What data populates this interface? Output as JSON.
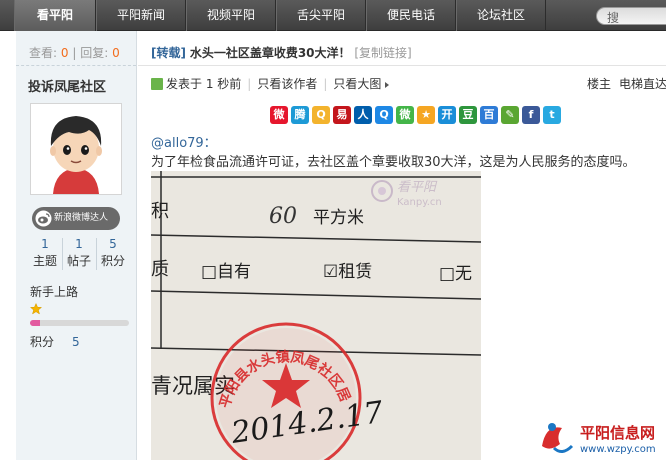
{
  "nav": {
    "tabs": [
      "看平阳",
      "平阳新闻",
      "视频平阳",
      "舌尖平阳",
      "便民电话",
      "论坛社区"
    ],
    "active_index": 0,
    "search_placeholder": "搜"
  },
  "sidebar": {
    "views_label": "查看:",
    "views_value": "0",
    "replies_label": "回复:",
    "replies_value": "0",
    "separator": "|",
    "username": "投诉凤尾社区",
    "weibo_badge": "新浪微博达人",
    "counts": [
      {
        "value": "1",
        "label": "主题"
      },
      {
        "value": "1",
        "label": "帖子"
      },
      {
        "value": "5",
        "label": "积分"
      }
    ],
    "level": "新手上路",
    "level_progress": 0.1,
    "points_label": "积分",
    "points_value": "5"
  },
  "post": {
    "tag": "[转载]",
    "title": "水头一社区盖章收费30大洋！",
    "copy_link": "[复制链接]",
    "posted": "发表于 1 秒前",
    "only_author": "只看该作者",
    "large_images": "只看大图",
    "floor": "楼主",
    "elevator": "电梯直达",
    "mention": "@allo79：",
    "body": "为了年检食品流通许可证，去社区盖个章要收取30大洋，这是为人民服务的态度吗。"
  },
  "photo": {
    "area_number": "60",
    "area_unit": "平方米",
    "watermark_title": "看平阳",
    "watermark_domain": "Kanpy.cn",
    "option_own": "□自有",
    "option_rent": "☑租赁",
    "option_none": "□无",
    "left_char_1": "积",
    "left_char_2": "质",
    "status_text": "青况属实",
    "seal_text": "平阳县水头镇凤尾社区居委会",
    "date_hand": "2014.2.17"
  },
  "watermark": {
    "site_name": "平阳信息网",
    "site_url": "www.wzpy.com"
  },
  "share_icons": [
    "sina-weibo",
    "tencent-weibo",
    "qzone",
    "netease",
    "renren",
    "qq",
    "wechat",
    "favorite",
    "kaixin",
    "douban",
    "baidu",
    "edit",
    "facebook",
    "twitter"
  ],
  "colors": {
    "accent_blue": "#336699",
    "count_orange": "#f26c1c",
    "nav_bg": "#4a4a4a",
    "seal_red": "#d8292a"
  }
}
